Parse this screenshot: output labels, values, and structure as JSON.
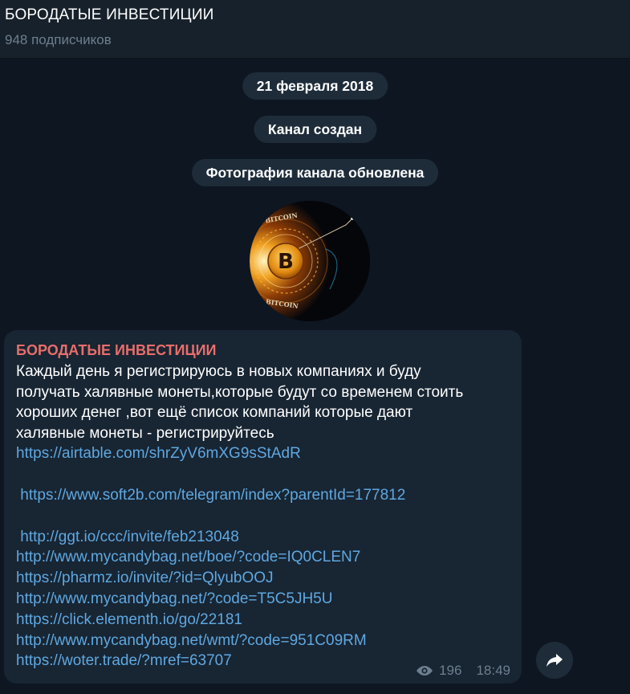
{
  "header": {
    "title": "БОРОДАТЫЕ ИНВЕСТИЦИИ",
    "subscribers": "948 подписчиков"
  },
  "service": {
    "date": "21 февраля 2018",
    "created": "Канал создан",
    "photo_updated": "Фотография канала обновлена"
  },
  "avatar": {
    "logo_text_top": "BITCOIN",
    "logo_text_bottom": "BITCOIN",
    "symbol": "B"
  },
  "message": {
    "author": "БОРОДАТЫЕ ИНВЕСТИЦИИ",
    "text_lines": [
      "Каждый день я регистрируюсь в новых компаниях и буду",
      "получать халявные монеты,которые будут со временем стоить",
      "хороших денег ,вот ещё список компаний которые дают",
      "халявные монеты - регистрируйтесь"
    ],
    "links": [
      "https://airtable.com/shrZyV6mXG9sStAdR",
      " https://www.soft2b.com/telegram/index?parentId=177812",
      " http://ggt.io/ccc/invite/feb213048",
      "http://www.mycandybag.net/boe/?code=IQ0CLEN7",
      "https://pharmz.io/invite/?id=QlyubOOJ",
      "http://www.mycandybag.net/?code=T5C5JH5U",
      "https://click.elementh.io/go/22181",
      "http://www.mycandybag.net/wmt/?code=951C09RM",
      "https://woter.trade/?mref=63707"
    ],
    "views": "196",
    "time": "18:49"
  },
  "icons": {
    "views": "eye-icon",
    "share": "share-arrow-icon"
  },
  "colors": {
    "background": "#0e1621",
    "header": "#17212b",
    "bubble": "#182533",
    "author": "#e86e6a",
    "link": "#5fa8e0",
    "muted": "#6d7f8f"
  }
}
